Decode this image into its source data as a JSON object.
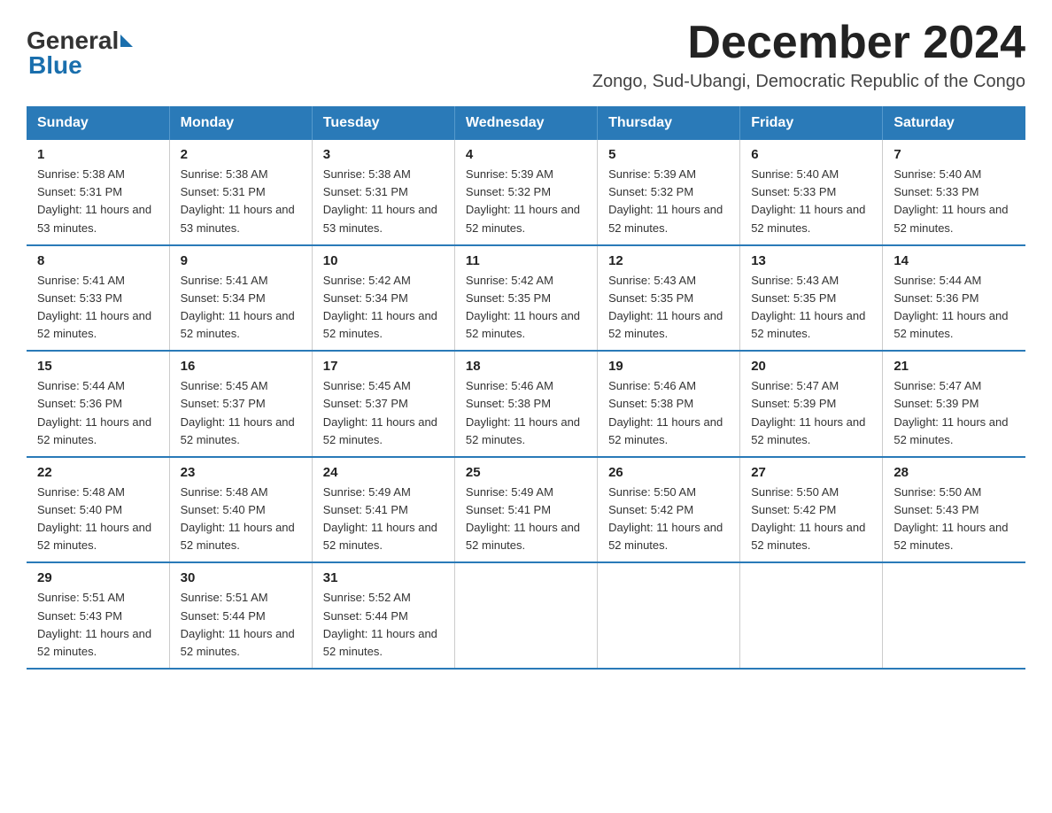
{
  "header": {
    "logo_general": "General",
    "logo_blue": "Blue",
    "title": "December 2024",
    "subtitle": "Zongo, Sud-Ubangi, Democratic Republic of the Congo"
  },
  "days_of_week": [
    "Sunday",
    "Monday",
    "Tuesday",
    "Wednesday",
    "Thursday",
    "Friday",
    "Saturday"
  ],
  "weeks": [
    [
      {
        "day": "1",
        "sunrise": "5:38 AM",
        "sunset": "5:31 PM",
        "daylight": "11 hours and 53 minutes."
      },
      {
        "day": "2",
        "sunrise": "5:38 AM",
        "sunset": "5:31 PM",
        "daylight": "11 hours and 53 minutes."
      },
      {
        "day": "3",
        "sunrise": "5:38 AM",
        "sunset": "5:31 PM",
        "daylight": "11 hours and 53 minutes."
      },
      {
        "day": "4",
        "sunrise": "5:39 AM",
        "sunset": "5:32 PM",
        "daylight": "11 hours and 52 minutes."
      },
      {
        "day": "5",
        "sunrise": "5:39 AM",
        "sunset": "5:32 PM",
        "daylight": "11 hours and 52 minutes."
      },
      {
        "day": "6",
        "sunrise": "5:40 AM",
        "sunset": "5:33 PM",
        "daylight": "11 hours and 52 minutes."
      },
      {
        "day": "7",
        "sunrise": "5:40 AM",
        "sunset": "5:33 PM",
        "daylight": "11 hours and 52 minutes."
      }
    ],
    [
      {
        "day": "8",
        "sunrise": "5:41 AM",
        "sunset": "5:33 PM",
        "daylight": "11 hours and 52 minutes."
      },
      {
        "day": "9",
        "sunrise": "5:41 AM",
        "sunset": "5:34 PM",
        "daylight": "11 hours and 52 minutes."
      },
      {
        "day": "10",
        "sunrise": "5:42 AM",
        "sunset": "5:34 PM",
        "daylight": "11 hours and 52 minutes."
      },
      {
        "day": "11",
        "sunrise": "5:42 AM",
        "sunset": "5:35 PM",
        "daylight": "11 hours and 52 minutes."
      },
      {
        "day": "12",
        "sunrise": "5:43 AM",
        "sunset": "5:35 PM",
        "daylight": "11 hours and 52 minutes."
      },
      {
        "day": "13",
        "sunrise": "5:43 AM",
        "sunset": "5:35 PM",
        "daylight": "11 hours and 52 minutes."
      },
      {
        "day": "14",
        "sunrise": "5:44 AM",
        "sunset": "5:36 PM",
        "daylight": "11 hours and 52 minutes."
      }
    ],
    [
      {
        "day": "15",
        "sunrise": "5:44 AM",
        "sunset": "5:36 PM",
        "daylight": "11 hours and 52 minutes."
      },
      {
        "day": "16",
        "sunrise": "5:45 AM",
        "sunset": "5:37 PM",
        "daylight": "11 hours and 52 minutes."
      },
      {
        "day": "17",
        "sunrise": "5:45 AM",
        "sunset": "5:37 PM",
        "daylight": "11 hours and 52 minutes."
      },
      {
        "day": "18",
        "sunrise": "5:46 AM",
        "sunset": "5:38 PM",
        "daylight": "11 hours and 52 minutes."
      },
      {
        "day": "19",
        "sunrise": "5:46 AM",
        "sunset": "5:38 PM",
        "daylight": "11 hours and 52 minutes."
      },
      {
        "day": "20",
        "sunrise": "5:47 AM",
        "sunset": "5:39 PM",
        "daylight": "11 hours and 52 minutes."
      },
      {
        "day": "21",
        "sunrise": "5:47 AM",
        "sunset": "5:39 PM",
        "daylight": "11 hours and 52 minutes."
      }
    ],
    [
      {
        "day": "22",
        "sunrise": "5:48 AM",
        "sunset": "5:40 PM",
        "daylight": "11 hours and 52 minutes."
      },
      {
        "day": "23",
        "sunrise": "5:48 AM",
        "sunset": "5:40 PM",
        "daylight": "11 hours and 52 minutes."
      },
      {
        "day": "24",
        "sunrise": "5:49 AM",
        "sunset": "5:41 PM",
        "daylight": "11 hours and 52 minutes."
      },
      {
        "day": "25",
        "sunrise": "5:49 AM",
        "sunset": "5:41 PM",
        "daylight": "11 hours and 52 minutes."
      },
      {
        "day": "26",
        "sunrise": "5:50 AM",
        "sunset": "5:42 PM",
        "daylight": "11 hours and 52 minutes."
      },
      {
        "day": "27",
        "sunrise": "5:50 AM",
        "sunset": "5:42 PM",
        "daylight": "11 hours and 52 minutes."
      },
      {
        "day": "28",
        "sunrise": "5:50 AM",
        "sunset": "5:43 PM",
        "daylight": "11 hours and 52 minutes."
      }
    ],
    [
      {
        "day": "29",
        "sunrise": "5:51 AM",
        "sunset": "5:43 PM",
        "daylight": "11 hours and 52 minutes."
      },
      {
        "day": "30",
        "sunrise": "5:51 AM",
        "sunset": "5:44 PM",
        "daylight": "11 hours and 52 minutes."
      },
      {
        "day": "31",
        "sunrise": "5:52 AM",
        "sunset": "5:44 PM",
        "daylight": "11 hours and 52 minutes."
      },
      null,
      null,
      null,
      null
    ]
  ]
}
